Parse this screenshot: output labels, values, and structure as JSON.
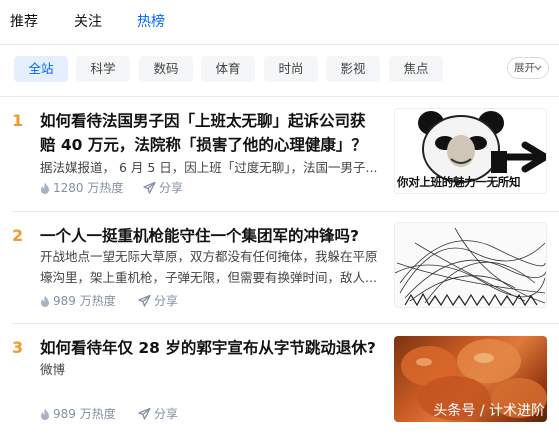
{
  "top_tabs": [
    {
      "label": "推荐",
      "active": false
    },
    {
      "label": "关注",
      "active": false
    },
    {
      "label": "热榜",
      "active": true
    }
  ],
  "filters": {
    "chips": [
      "全站",
      "科学",
      "数码",
      "体育",
      "时尚",
      "影视",
      "焦点"
    ],
    "active_index": 0,
    "expand_label": "展开"
  },
  "items": [
    {
      "rank": "1",
      "title": "如何看待法国男子因「上班太无聊」起诉公司获赔 40 万元，法院称「损害了他的心理健康」？",
      "excerpt": "据法媒报道， 6 月 5 日，因上班「过度无聊」，法国一男子...",
      "heat": "1280 万热度",
      "share": "分享",
      "thumb_caption": "你对上班的魅力一无所知",
      "thumb_icon": "panda-meme-image"
    },
    {
      "rank": "2",
      "title": "一个人一挺重机枪能守住一个集团军的冲锋吗?",
      "excerpt": "开战地点一望无际大草原，双方都没有任何掩体，我躲在平原壕沟里，架上重机枪，子弹无限，但需要有换弹时间，敌人...",
      "heat": "989 万热度",
      "share": "分享",
      "thumb_icon": "sketch-diagram-image"
    },
    {
      "rank": "3",
      "title": "如何看待年仅 28 岁的郭宇宣布从字节跳动退休?",
      "excerpt": "微博",
      "heat": "989 万热度",
      "share": "分享",
      "thumb_caption": "头条号 / 计术进阶",
      "thumb_icon": "braised-pork-food-image"
    }
  ],
  "colors": {
    "accent": "#0066ff",
    "rank": "#f09a2d",
    "meta": "#8590a6"
  }
}
